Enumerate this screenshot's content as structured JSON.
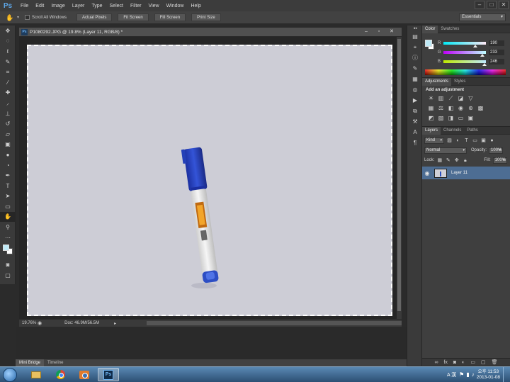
{
  "app": {
    "logo": "Ps",
    "menu": [
      "File",
      "Edit",
      "Image",
      "Layer",
      "Type",
      "Select",
      "Filter",
      "View",
      "Window",
      "Help"
    ]
  },
  "options_bar": {
    "scroll_all_label": "Scroll All Windows",
    "buttons": [
      "Actual Pixels",
      "Fit Screen",
      "Fill Screen",
      "Print Size"
    ],
    "workspace": "Essentials"
  },
  "document": {
    "title": "P1080292.JPG @ 19.8% (Layer 11, RGB/8) *",
    "zoom": "19.76%",
    "doc_info": "Doc: 46.9M/56.5M"
  },
  "bottom_tabs": [
    "Mini Bridge",
    "Timeline"
  ],
  "color_panel": {
    "tabs": [
      "Color",
      "Swatches"
    ],
    "foreground_color": "#bee9f6",
    "background_color": "#ffffff",
    "channels": [
      {
        "label": "R",
        "value": "190"
      },
      {
        "label": "G",
        "value": "233"
      },
      {
        "label": "B",
        "value": "246"
      }
    ]
  },
  "adjustments_panel": {
    "tabs": [
      "Adjustments",
      "Styles"
    ],
    "title": "Add an adjustment"
  },
  "layers_panel": {
    "tabs": [
      "Layers",
      "Channels",
      "Paths"
    ],
    "filter_kind": "Kind",
    "blend_mode": "Normal",
    "opacity_label": "Opacity:",
    "opacity_value": "100%",
    "lock_label": "Lock:",
    "fill_label": "Fill:",
    "fill_value": "100%",
    "layers": [
      {
        "name": "Layer 11"
      }
    ]
  },
  "taskbar": {
    "language": "A 漢",
    "time": "오후 11:53",
    "date": "2013-01-08"
  }
}
